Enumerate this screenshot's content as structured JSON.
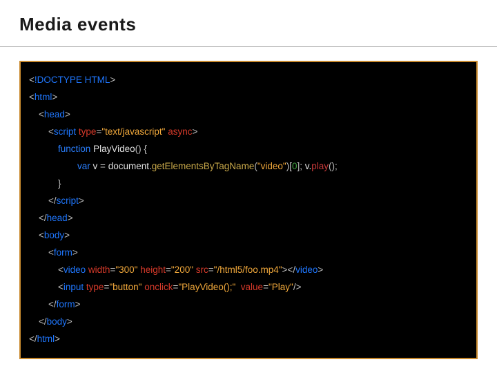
{
  "title": "Media events",
  "code": {
    "l1_open": "<",
    "l1_doctype": "!DOCTYPE HTML",
    "l1_close": ">",
    "l2_open": "<",
    "l2_tag": "html",
    "l2_close": ">",
    "l3_open": "<",
    "l3_tag": "head",
    "l3_close": ">",
    "l4_open": "<",
    "l4_tag": "script ",
    "l4_attr1": "type",
    "l4_eq1": "=",
    "l4_val1": "\"text/javascript\"",
    "l4_sp": " ",
    "l4_attr2": "async",
    "l4_close": ">",
    "l5_kw": "function",
    "l5_sp": " ",
    "l5_name": "PlayVideo",
    "l5_paren": "() {",
    "l6_kw": "var",
    "l6_sp1": " ",
    "l6_v": "v",
    "l6_sp2": " ",
    "l6_eq": "=",
    "l6_sp3": " ",
    "l6_doc": "document.",
    "l6_m1": "getElementsByTagName",
    "l6_p1": "(",
    "l6_arg": "\"video\"",
    "l6_p2": ")[",
    "l6_idx": "0",
    "l6_p3": "]; ",
    "l6_v2": "v.",
    "l6_m2": "play",
    "l6_p4": "();",
    "l7_brace": "}",
    "l8_open": "</",
    "l8_tag": "script",
    "l8_close": ">",
    "l9_open": "</",
    "l9_tag": "head",
    "l9_close": ">",
    "l10_open": "<",
    "l10_tag": "body",
    "l10_close": ">",
    "l11_open": "<",
    "l11_tag": "form",
    "l11_close": ">",
    "l12_open": "<",
    "l12_tag": "video ",
    "l12_a1": "width",
    "l12_e1": "=",
    "l12_v1": "\"300\"",
    "l12_s1": " ",
    "l12_a2": "height",
    "l12_e2": "=",
    "l12_v2": "\"200\"",
    "l12_s2": " ",
    "l12_a3": "src",
    "l12_e3": "=",
    "l12_v3": "\"/html5/foo.mp4\"",
    "l12_mid": "></",
    "l12_tag2": "video",
    "l12_close": ">",
    "l13_open": "<",
    "l13_tag": "input ",
    "l13_a1": "type",
    "l13_e1": "=",
    "l13_v1": "\"button\"",
    "l13_s1": " ",
    "l13_a2": "onclick",
    "l13_e2": "=",
    "l13_v2": "\"PlayVideo();\"",
    "l13_s2": "  ",
    "l13_a3": "value",
    "l13_e3": "=",
    "l13_v3": "\"Play\"",
    "l13_close": "/>",
    "l14_open": "</",
    "l14_tag": "form",
    "l14_close": ">",
    "l15_open": "</",
    "l15_tag": "body",
    "l15_close": ">",
    "l16_open": "</",
    "l16_tag": "html",
    "l16_close": ">"
  }
}
